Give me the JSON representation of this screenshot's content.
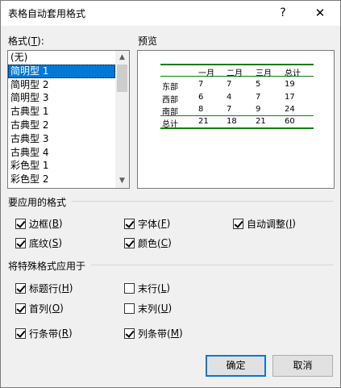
{
  "dialog": {
    "title": "表格自动套用格式",
    "help": "?",
    "close": "✕"
  },
  "formats": {
    "label_prefix": "格式(",
    "label_key": "T",
    "label_suffix": "):",
    "items": [
      "(无)",
      "简明型 1",
      "简明型 2",
      "简明型 3",
      "古典型 1",
      "古典型 2",
      "古典型 3",
      "古典型 4",
      "彩色型 1",
      "彩色型 2"
    ],
    "selected_index": 1
  },
  "preview": {
    "label": "预览",
    "header": [
      "",
      "一月",
      "二月",
      "三月",
      "总计"
    ],
    "rows": [
      [
        "东部",
        "7",
        "7",
        "5",
        "19"
      ],
      [
        "西部",
        "6",
        "4",
        "7",
        "17"
      ],
      [
        "南部",
        "8",
        "7",
        "9",
        "24"
      ],
      [
        "总计",
        "21",
        "18",
        "21",
        "60"
      ]
    ],
    "accent": "#107c10"
  },
  "apply_group": {
    "label": "要应用的格式",
    "options": [
      {
        "text": "边框(",
        "key": "B",
        "end": ")",
        "checked": true
      },
      {
        "text": "字体(",
        "key": "F",
        "end": ")",
        "checked": true
      },
      {
        "text": "自动调整(",
        "key": "I",
        "end": ")",
        "checked": true
      },
      {
        "text": "底纹(",
        "key": "S",
        "end": ")",
        "checked": true
      },
      {
        "text": "颜色(",
        "key": "C",
        "end": ")",
        "checked": true
      }
    ]
  },
  "special_group": {
    "label": "将特殊格式应用于",
    "options": [
      {
        "text": "标题行(",
        "key": "H",
        "end": ")",
        "checked": true
      },
      {
        "text": "末行(",
        "key": "L",
        "end": ")",
        "checked": false
      },
      {
        "text": "首列(",
        "key": "O",
        "end": ")",
        "checked": true
      },
      {
        "text": "末列(",
        "key": "U",
        "end": ")",
        "checked": false
      },
      {
        "text": "行条带(",
        "key": "R",
        "end": ")",
        "checked": true
      },
      {
        "text": "列条带(",
        "key": "M",
        "end": ")",
        "checked": true
      }
    ]
  },
  "buttons": {
    "ok": "确定",
    "cancel": "取消"
  },
  "colors": {
    "selection": "#0078d7"
  }
}
